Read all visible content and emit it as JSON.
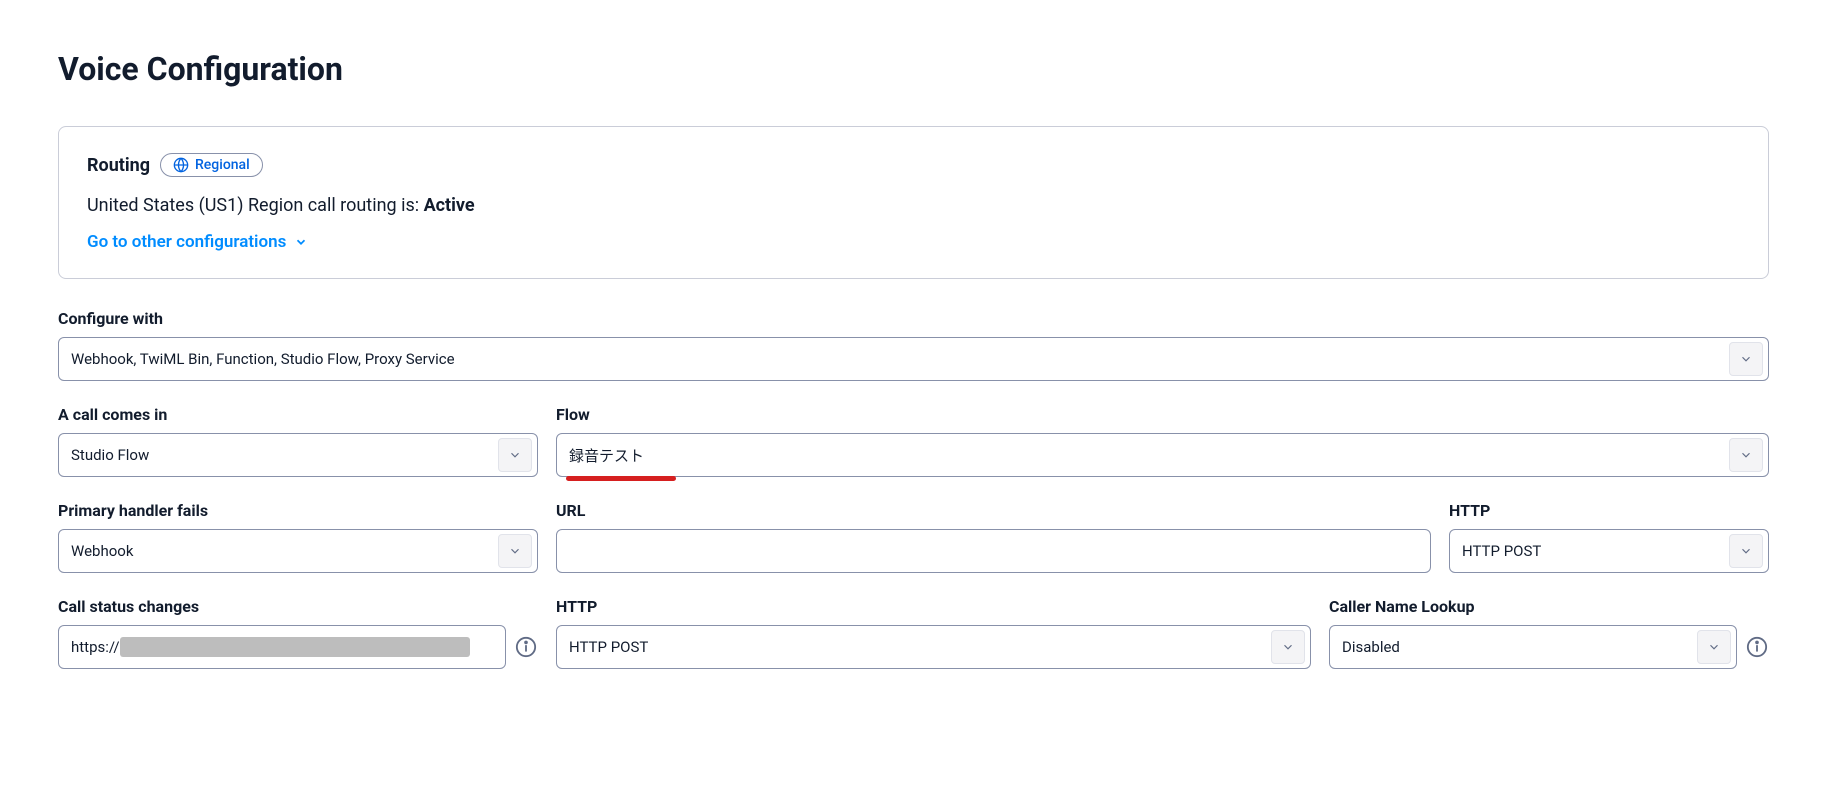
{
  "title": "Voice Configuration",
  "routing": {
    "title": "Routing",
    "pill": "Regional",
    "status_prefix": "United States (US1) Region call routing is: ",
    "status_value": "Active",
    "link": "Go to other configurations"
  },
  "configure_with": {
    "label": "Configure with",
    "value": "Webhook, TwiML Bin, Function, Studio Flow, Proxy Service"
  },
  "call_comes_in": {
    "label": "A call comes in",
    "value": "Studio Flow"
  },
  "flow": {
    "label": "Flow",
    "value": "録音テスト"
  },
  "primary_handler_fails": {
    "label": "Primary handler fails",
    "value": "Webhook"
  },
  "url": {
    "label": "URL",
    "value": ""
  },
  "http1": {
    "label": "HTTP",
    "value": "HTTP POST"
  },
  "call_status_changes": {
    "label": "Call status changes",
    "prefix": "https://"
  },
  "http2": {
    "label": "HTTP",
    "value": "HTTP POST"
  },
  "caller_name_lookup": {
    "label": "Caller Name Lookup",
    "value": "Disabled"
  }
}
